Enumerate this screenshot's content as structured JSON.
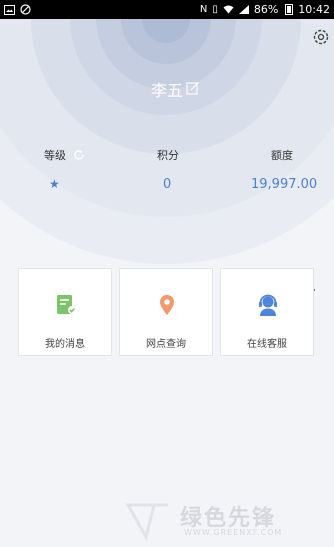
{
  "status_bar": {
    "left_icons": [
      "gallery-icon",
      "no-sync-icon"
    ],
    "battery": "86%",
    "time": "10:42"
  },
  "profile": {
    "name": "李五"
  },
  "stats": {
    "level_label": "等级",
    "level_value": "★",
    "points_label": "积分",
    "points_value": "0",
    "quota_label": "额度",
    "quota_value": "19,997.00"
  },
  "cards": [
    {
      "label": "我的消息",
      "icon": "message-icon",
      "color": "#7cc36b"
    },
    {
      "label": "网点查询",
      "icon": "location-pin-icon",
      "color": "#f29a6b"
    },
    {
      "label": "在线客服",
      "icon": "customer-service-icon",
      "color": "#4f86d9"
    }
  ],
  "watermark": {
    "title": "绿色先锋",
    "subtitle": "WWW.GREENXF.COM"
  },
  "colors": {
    "accent": "#4a7fd2",
    "background": "#f3f4f7"
  }
}
